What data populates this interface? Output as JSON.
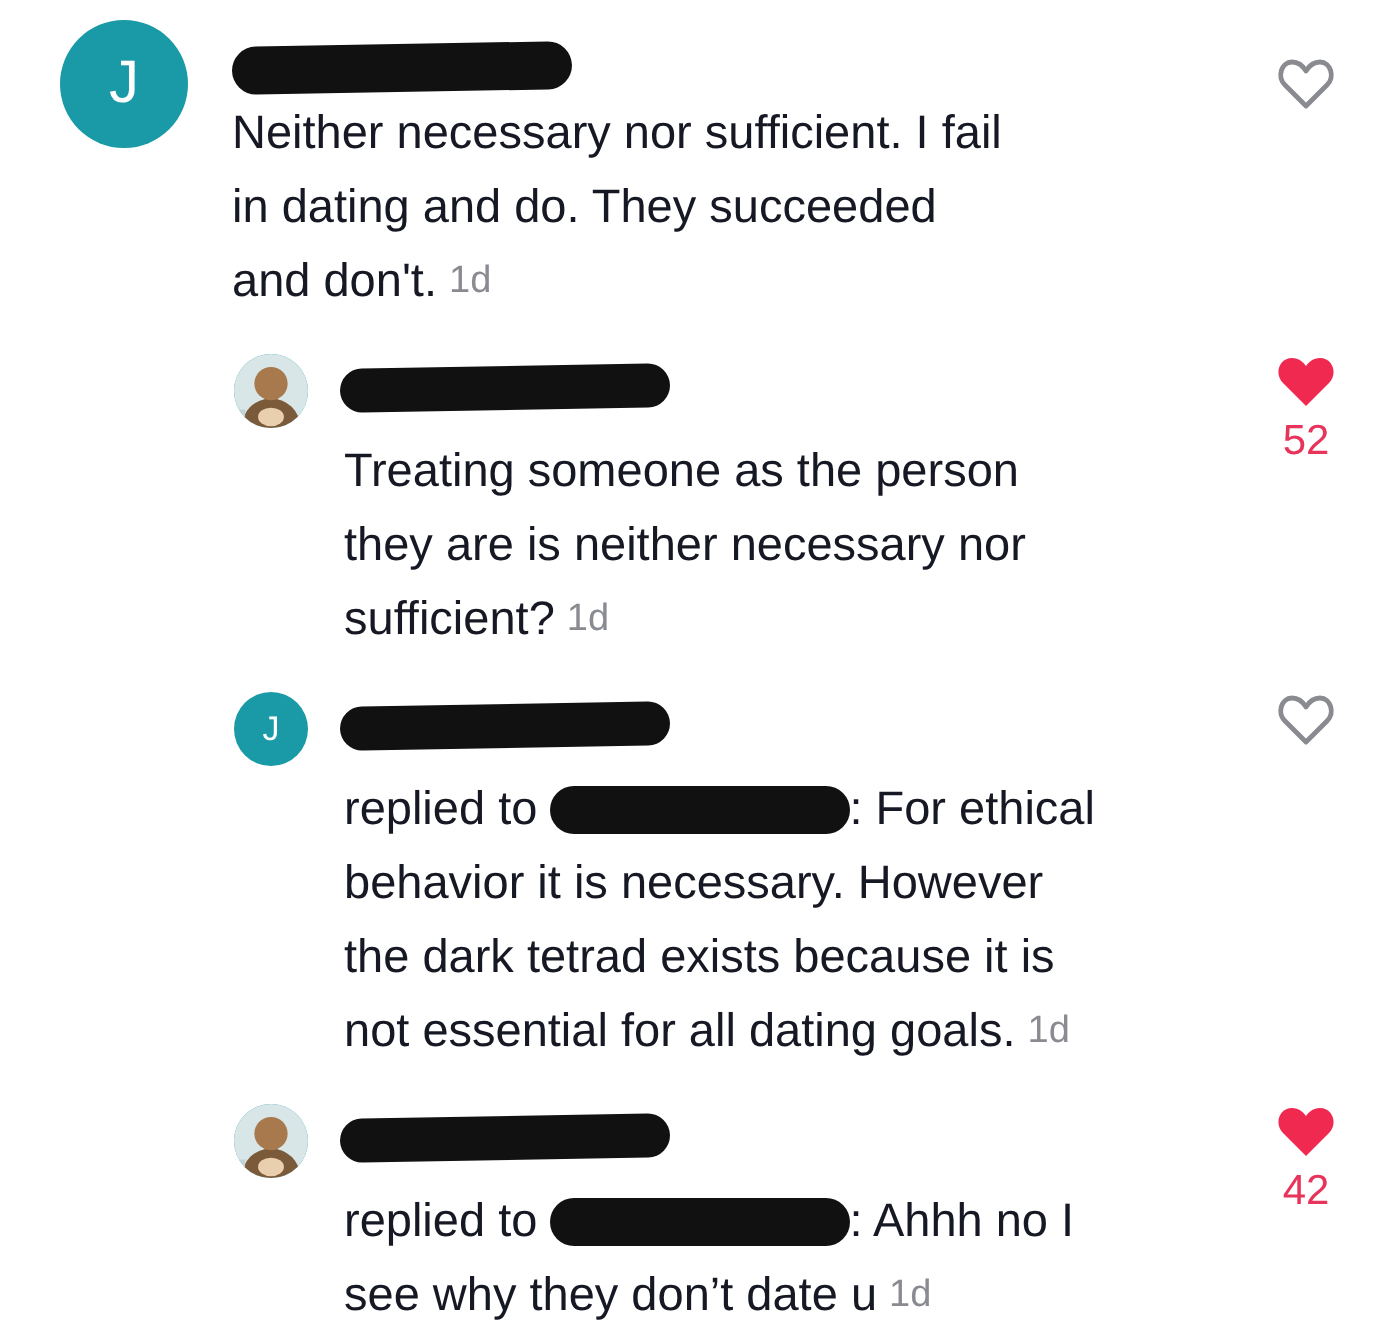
{
  "comments": [
    {
      "avatar": {
        "kind": "letter",
        "letter": "J"
      },
      "lines": [
        "Neither necessary nor sufficient. I fail",
        "in dating and do. They succeeded",
        "and don't."
      ],
      "time": "1d",
      "liked": false,
      "replies": [
        {
          "avatar": {
            "kind": "picture"
          },
          "lines": [
            "Treating someone as the person",
            "they are is neither necessary nor",
            "sufficient?"
          ],
          "time": "1d",
          "liked": true,
          "likes": "52"
        },
        {
          "avatar": {
            "kind": "letter",
            "letter": "J"
          },
          "reply_prefix": "replied to",
          "lines": [
            ": For ethical",
            "behavior it is necessary. However",
            "the dark tetrad exists because it is",
            "not essential for all dating goals."
          ],
          "time": "1d",
          "liked": false
        },
        {
          "avatar": {
            "kind": "picture"
          },
          "reply_prefix": "replied to",
          "lines": [
            ": Ahhh no I",
            "see why they don’t date u"
          ],
          "time": "1d",
          "liked": true,
          "likes": "42"
        }
      ]
    }
  ]
}
